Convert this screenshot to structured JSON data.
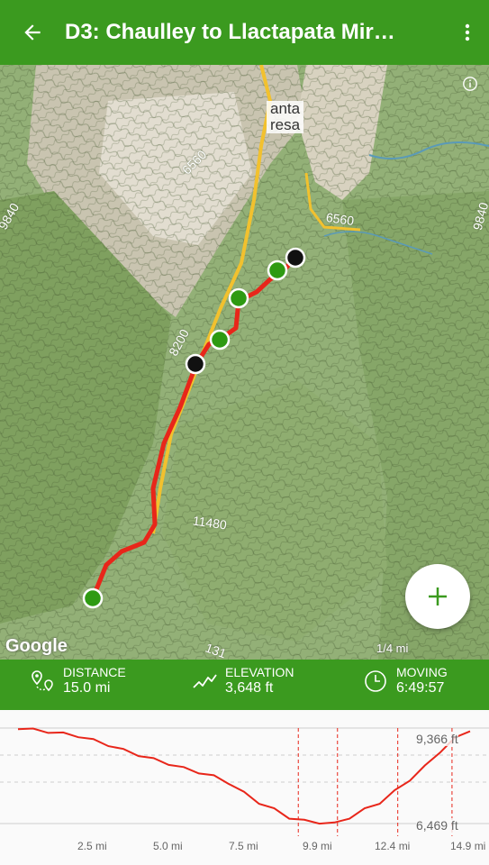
{
  "header": {
    "title": "D3: Chaulley to Llactapata Mir…",
    "back_icon": "arrow-left-icon",
    "menu_icon": "more-vert-icon"
  },
  "map": {
    "town_line1": "anta",
    "town_line2": "resa",
    "elevation_labels": [
      "6560",
      "6560",
      "8200",
      "11480",
      "9840",
      "131",
      "4200",
      "9840"
    ],
    "attribution": "Google",
    "scale": "1/4 mi",
    "fab_icon": "plus-icon",
    "colors": {
      "route": "#e8261a",
      "trail": "#f2c12e",
      "waypoint_green": "#2e9a12",
      "waypoint_black": "#111111"
    }
  },
  "stats": {
    "distance": {
      "label": "DISTANCE",
      "value": "15.0 mi",
      "icon": "route-pin-icon"
    },
    "elevation": {
      "label": "ELEVATION",
      "value": "3,648 ft",
      "icon": "elevation-trend-icon"
    },
    "moving": {
      "label": "MOVING",
      "value": "6:49:57",
      "icon": "clock-icon"
    }
  },
  "profile": {
    "max_label": "9,366 ft",
    "min_label": "6,469 ft",
    "x_ticks": [
      "2.5 mi",
      "5.0 mi",
      "7.5 mi",
      "9.9 mi",
      "12.4 mi",
      "14.9 mi"
    ]
  },
  "chart_data": {
    "type": "line",
    "x": [
      0,
      0.5,
      1,
      1.5,
      2,
      2.5,
      3,
      3.5,
      4,
      4.5,
      5,
      5.5,
      6,
      6.5,
      7,
      7.5,
      8,
      8.5,
      9,
      9.5,
      10,
      10.5,
      11,
      11.5,
      12,
      12.5,
      13,
      13.5,
      14,
      14.5,
      15
    ],
    "values": [
      9366,
      9320,
      9250,
      9200,
      9120,
      9000,
      8850,
      8700,
      8550,
      8420,
      8280,
      8150,
      8020,
      7900,
      7700,
      7400,
      7100,
      6900,
      6650,
      6550,
      6500,
      6469,
      6650,
      6900,
      7100,
      7450,
      7800,
      8200,
      8650,
      9050,
      9300
    ],
    "markers_x": [
      9.3,
      10.6,
      12.6,
      14.4
    ],
    "ylim": [
      6469,
      9366
    ],
    "xlim": [
      0,
      15
    ]
  }
}
